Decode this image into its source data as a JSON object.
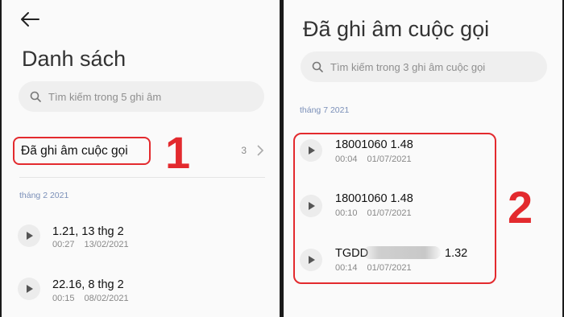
{
  "left": {
    "title": "Danh sách",
    "search_placeholder": "Tìm kiếm trong 5 ghi âm",
    "folder": {
      "label": "Đã ghi âm cuộc gọi",
      "count": "3"
    },
    "section": "tháng 2 2021",
    "recordings": [
      {
        "name": "1.21, 13 thg 2",
        "duration": "00:27",
        "date": "13/02/2021"
      },
      {
        "name": "22.16, 8 thg 2",
        "duration": "00:15",
        "date": "08/02/2021"
      }
    ]
  },
  "right": {
    "title": "Đã ghi âm cuộc gọi",
    "search_placeholder": "Tìm kiếm trong 3 ghi âm cuộc gọi",
    "section": "tháng 7 2021",
    "recordings": [
      {
        "name": "18001060 1.48",
        "duration": "00:04",
        "date": "01/07/2021"
      },
      {
        "name": "18001060 1.48",
        "duration": "00:10",
        "date": "01/07/2021"
      },
      {
        "name": "TGDD",
        "name_suffix": "1.32",
        "duration": "00:14",
        "date": "01/07/2021"
      }
    ]
  },
  "annotations": {
    "step1": "1",
    "step2": "2",
    "color": "#e32a2e"
  }
}
